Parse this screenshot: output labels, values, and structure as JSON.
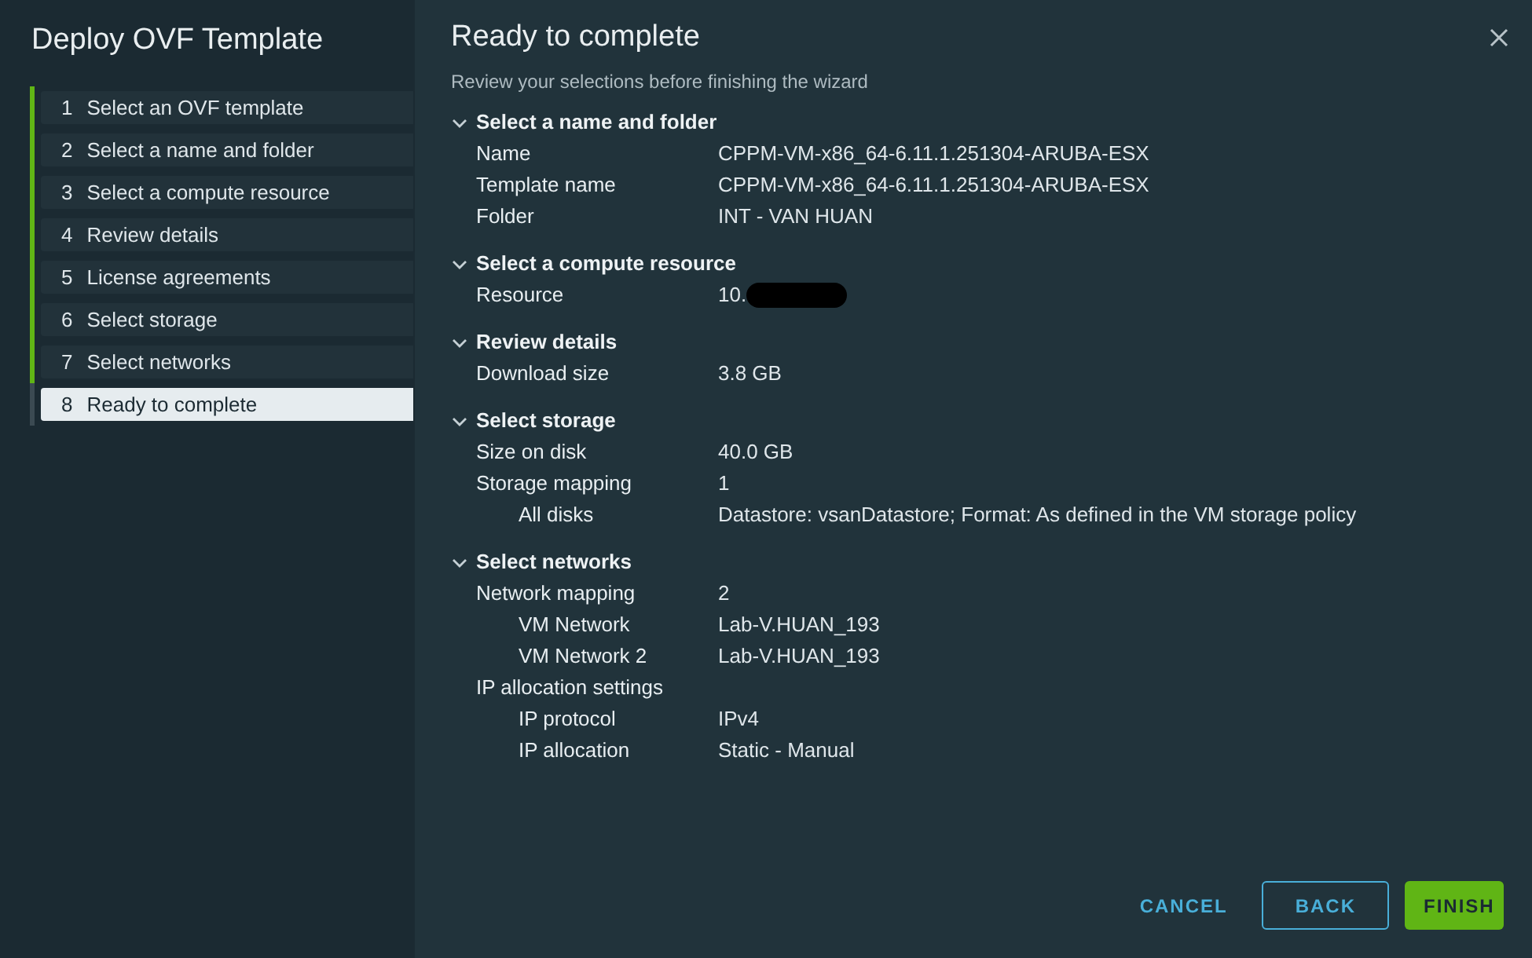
{
  "sidebar": {
    "title": "Deploy OVF Template",
    "steps": [
      {
        "number": "1",
        "label": "Select an OVF template",
        "completed": true,
        "selected": false
      },
      {
        "number": "2",
        "label": "Select a name and folder",
        "completed": true,
        "selected": false
      },
      {
        "number": "3",
        "label": "Select a compute resource",
        "completed": true,
        "selected": false
      },
      {
        "number": "4",
        "label": "Review details",
        "completed": true,
        "selected": false
      },
      {
        "number": "5",
        "label": "License agreements",
        "completed": true,
        "selected": false
      },
      {
        "number": "6",
        "label": "Select storage",
        "completed": true,
        "selected": false
      },
      {
        "number": "7",
        "label": "Select networks",
        "completed": true,
        "selected": false
      },
      {
        "number": "8",
        "label": "Ready to complete",
        "completed": false,
        "selected": true
      }
    ]
  },
  "main": {
    "title": "Ready to complete",
    "subtitle": "Review your selections before finishing the wizard",
    "sections": [
      {
        "title": "Select a name and folder",
        "expanded": true,
        "rows": [
          {
            "label": "Name",
            "value": "CPPM-VM-x86_64-6.11.1.251304-ARUBA-ESX"
          },
          {
            "label": "Template name",
            "value": "CPPM-VM-x86_64-6.11.1.251304-ARUBA-ESX"
          },
          {
            "label": "Folder",
            "value": "INT - VAN HUAN"
          }
        ]
      },
      {
        "title": "Select a compute resource",
        "expanded": true,
        "rows": [
          {
            "label": "Resource",
            "value": "10.",
            "redacted": true
          }
        ]
      },
      {
        "title": "Review details",
        "expanded": true,
        "rows": [
          {
            "label": "Download size",
            "value": "3.8 GB"
          }
        ]
      },
      {
        "title": "Select storage",
        "expanded": true,
        "rows": [
          {
            "label": "Size on disk",
            "value": "40.0 GB"
          },
          {
            "label": "Storage mapping",
            "value": "1",
            "children": [
              {
                "label": "All disks",
                "value": "Datastore: vsanDatastore; Format: As defined in the VM storage policy"
              }
            ]
          }
        ]
      },
      {
        "title": "Select networks",
        "expanded": true,
        "rows": [
          {
            "label": "Network mapping",
            "value": "2",
            "children": [
              {
                "label": "VM Network",
                "value": "Lab-V.HUAN_193"
              },
              {
                "label": "VM Network 2",
                "value": "Lab-V.HUAN_193"
              }
            ]
          },
          {
            "label": "IP allocation settings",
            "children": [
              {
                "label": "IP protocol",
                "value": "IPv4"
              },
              {
                "label": "IP allocation",
                "value": "Static - Manual"
              }
            ]
          }
        ]
      }
    ]
  },
  "buttons": [
    {
      "kind": "link",
      "label": "CANCEL"
    },
    {
      "kind": "outline",
      "label": "BACK"
    },
    {
      "kind": "primary",
      "label": "FINISH"
    }
  ]
}
